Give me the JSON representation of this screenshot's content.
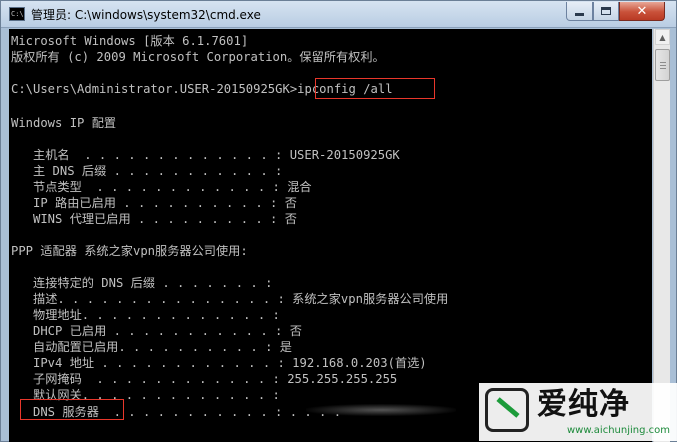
{
  "window": {
    "title": "管理员: C:\\windows\\system32\\cmd.exe",
    "app_icon": "cmd-icon",
    "icon_text": "C:\\"
  },
  "console": {
    "lines": [
      "Microsoft Windows [版本 6.1.7601]",
      "版权所有 (c) 2009 Microsoft Corporation。保留所有权利。",
      "",
      "C:\\Users\\Administrator.USER-20150925GK>ipconfig /all",
      "",
      "Windows IP 配置",
      "",
      "   主机名  . . . . . . . . . . . . . : USER-20150925GK",
      "   主 DNS 后缀 . . . . . . . . . . . :",
      "   节点类型  . . . . . . . . . . . . : 混合",
      "   IP 路由已启用 . . . . . . . . . . : 否",
      "   WINS 代理已启用 . . . . . . . . . : 否",
      "",
      "PPP 适配器 系统之家vpn服务器公司使用:",
      "",
      "   连接特定的 DNS 后缀 . . . . . . . :",
      "   描述. . . . . . . . . . . . . . . : 系统之家vpn服务器公司使用",
      "   物理地址. . . . . . . . . . . . . :",
      "   DHCP 已启用 . . . . . . . . . . . : 否",
      "   自动配置已启用. . . . . . . . . . : 是",
      "   IPv4 地址 . . . . . . . . . . . . : 192.168.0.203(首选)",
      "   子网掩码  . . . . . . . . . . . . : 255.255.255.255",
      "   默认网关. . . . . . . . . . . . . :",
      "   DNS 服务器  . . . . . . . . . . . : . . . ."
    ]
  },
  "watermark": {
    "brand": "爱纯净",
    "url": "www.aichunjing.com"
  },
  "colors": {
    "console_bg": "#000000",
    "console_fg": "#c0c0c0",
    "highlight": "#e8372b"
  }
}
